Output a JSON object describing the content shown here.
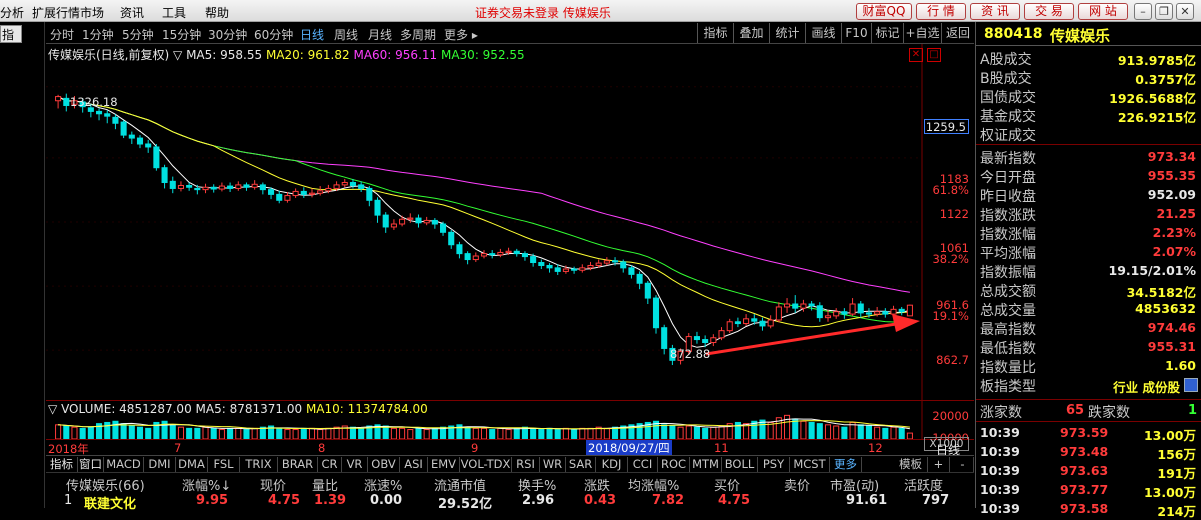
{
  "menubar": {
    "items": [
      "分析",
      "扩展行情市场",
      "资讯",
      "工具",
      "帮助"
    ],
    "notice": "证券交易未登录 传媒娱乐",
    "buttons": [
      "财富QQ",
      "行 情",
      "资 讯",
      "交 易",
      "网 站"
    ]
  },
  "leftstrip": {
    "label": "指标"
  },
  "periods": [
    "分时",
    "1分钟",
    "5分钟",
    "15分钟",
    "30分钟",
    "60分钟",
    "日线",
    "周线",
    "月线",
    "多周期",
    "更多 ▸"
  ],
  "active_period": "日线",
  "right_tools": [
    "指标",
    "叠加",
    "统计",
    "画线",
    "F10",
    "标记",
    "+自选",
    "返回"
  ],
  "main_legend": {
    "name": "传媒娱乐(日线,前复权)",
    "ma5": "MA5: 958.55",
    "ma20": "MA20: 961.82",
    "ma60": "MA60: 956.11",
    "ma30": "MA30: 952.55"
  },
  "price_axis": {
    "labels": [
      "1259.5",
      "1183",
      "61.8%",
      "1122",
      "1061",
      "38.2%",
      "961.6",
      "19.1%",
      "862.7"
    ],
    "highlight": "1259.5"
  },
  "annotations": {
    "high": "1326.18",
    "low": "872.88"
  },
  "volume_legend": {
    "volume": "VOLUME: 4851287.00",
    "ma5": "MA5: 8781371.00",
    "ma10": "MA10: 11374784.00"
  },
  "volume_axis": {
    "labels": [
      "20000",
      "10000",
      "X1000"
    ]
  },
  "xaxis": {
    "labels": [
      "2018年",
      "7",
      "8",
      "9",
      "2018/09/27/四",
      "11",
      "12"
    ],
    "period_button": "日线"
  },
  "indicators": [
    "指标",
    "窗口",
    "MACD",
    "DMI",
    "DMA",
    "FSL",
    "TRIX",
    "BRAR",
    "CR",
    "VR",
    "OBV",
    "ASI",
    "EMV",
    "VOL-TDX",
    "RSI",
    "WR",
    "SAR",
    "KDJ",
    "CCI",
    "ROC",
    "MTM",
    "BOLL",
    "PSY",
    "MCST",
    "更多"
  ],
  "indicator_right": [
    "模板",
    "+",
    "-"
  ],
  "table": {
    "headers": [
      "传媒娱乐(66)",
      "涨幅%↓",
      "现价",
      "量比",
      "涨速%",
      "流通市值",
      "换手%",
      "涨跌",
      "均涨幅%",
      "买价",
      "卖价",
      "市盈(动)",
      "活跃度"
    ],
    "row": [
      "1",
      "联建文化",
      "9.95",
      "4.75",
      "1.39",
      "0.00",
      "29.52亿",
      "2.96",
      "0.43",
      "7.82",
      "4.75",
      "",
      "91.61",
      "797"
    ]
  },
  "right_panel": {
    "code": "880418",
    "name": "传媒娱乐",
    "rows": [
      {
        "label": "A股成交",
        "value": "913.9785亿",
        "color": "yellow"
      },
      {
        "label": "B股成交",
        "value": "0.3757亿",
        "color": "yellow"
      },
      {
        "label": "国债成交",
        "value": "1926.5688亿",
        "color": "yellow"
      },
      {
        "label": "基金成交",
        "value": "226.9215亿",
        "color": "yellow"
      },
      {
        "label": "权证成交",
        "value": "",
        "color": "yellow"
      },
      {
        "label": "最新指数",
        "value": "973.34",
        "color": "red"
      },
      {
        "label": "今日开盘",
        "value": "955.35",
        "color": "red"
      },
      {
        "label": "昨日收盘",
        "value": "952.09",
        "color": "white"
      },
      {
        "label": "指数涨跌",
        "value": "21.25",
        "color": "red"
      },
      {
        "label": "指数涨幅",
        "value": "2.23%",
        "color": "red"
      },
      {
        "label": "平均涨幅",
        "value": "2.07%",
        "color": "red"
      },
      {
        "label": "指数振幅",
        "value": "19.15/2.01%",
        "color": "white"
      },
      {
        "label": "总成交额",
        "value": "34.5182亿",
        "color": "yellow"
      },
      {
        "label": "总成交量",
        "value": "4853632",
        "color": "yellow"
      },
      {
        "label": "最高指数",
        "value": "974.46",
        "color": "red"
      },
      {
        "label": "最低指数",
        "value": "955.31",
        "color": "red"
      },
      {
        "label": "指数量比",
        "value": "1.60",
        "color": "yellow"
      },
      {
        "label": "板指类型",
        "value": "行业 成份股",
        "color": "yellow"
      }
    ],
    "breadth": {
      "up_label": "涨家数",
      "up_value": "65",
      "down_label": "跌家数",
      "down_value": "1"
    },
    "trades": [
      {
        "time": "10:39",
        "price": "973.59",
        "vol": "13.00万"
      },
      {
        "time": "10:39",
        "price": "973.48",
        "vol": "156万"
      },
      {
        "time": "10:39",
        "price": "973.63",
        "vol": "191万"
      },
      {
        "time": "10:39",
        "price": "973.77",
        "vol": "13.00万"
      },
      {
        "time": "10:39",
        "price": "973.58",
        "vol": "214万"
      }
    ]
  },
  "chart_data": {
    "type": "candlestick",
    "ylim": [
      840,
      1380
    ],
    "candles": [
      [
        1318,
        1325,
        1305,
        1328
      ],
      [
        1322,
        1310,
        1300,
        1330
      ],
      [
        1312,
        1318,
        1305,
        1326
      ],
      [
        1316,
        1308,
        1298,
        1322
      ],
      [
        1306,
        1300,
        1290,
        1312
      ],
      [
        1300,
        1296,
        1285,
        1305
      ],
      [
        1296,
        1292,
        1280,
        1302
      ],
      [
        1290,
        1280,
        1270,
        1295
      ],
      [
        1282,
        1260,
        1255,
        1285
      ],
      [
        1260,
        1255,
        1245,
        1266
      ],
      [
        1255,
        1245,
        1238,
        1260
      ],
      [
        1245,
        1240,
        1230,
        1252
      ],
      [
        1240,
        1205,
        1200,
        1245
      ],
      [
        1205,
        1180,
        1170,
        1210
      ],
      [
        1182,
        1170,
        1162,
        1190
      ],
      [
        1170,
        1175,
        1165,
        1182
      ],
      [
        1175,
        1172,
        1166,
        1180
      ],
      [
        1170,
        1168,
        1160,
        1176
      ],
      [
        1168,
        1172,
        1162,
        1178
      ],
      [
        1172,
        1169,
        1163,
        1177
      ],
      [
        1169,
        1174,
        1165,
        1180
      ],
      [
        1174,
        1170,
        1164,
        1180
      ],
      [
        1170,
        1176,
        1166,
        1182
      ],
      [
        1176,
        1172,
        1166,
        1180
      ],
      [
        1172,
        1177,
        1168,
        1184
      ],
      [
        1176,
        1168,
        1160,
        1180
      ],
      [
        1168,
        1160,
        1152,
        1172
      ],
      [
        1160,
        1150,
        1145,
        1166
      ],
      [
        1150,
        1158,
        1146,
        1164
      ],
      [
        1158,
        1165,
        1154,
        1170
      ],
      [
        1165,
        1160,
        1154,
        1172
      ],
      [
        1160,
        1162,
        1155,
        1170
      ],
      [
        1162,
        1166,
        1158,
        1174
      ],
      [
        1166,
        1170,
        1162,
        1176
      ],
      [
        1170,
        1176,
        1166,
        1182
      ],
      [
        1176,
        1180,
        1172,
        1186
      ],
      [
        1180,
        1175,
        1170,
        1186
      ],
      [
        1176,
        1170,
        1164,
        1182
      ],
      [
        1170,
        1150,
        1140,
        1174
      ],
      [
        1150,
        1125,
        1112,
        1155
      ],
      [
        1125,
        1105,
        1095,
        1130
      ],
      [
        1105,
        1110,
        1100,
        1118
      ],
      [
        1110,
        1118,
        1106,
        1124
      ],
      [
        1118,
        1120,
        1112,
        1128
      ],
      [
        1120,
        1112,
        1104,
        1126
      ],
      [
        1112,
        1116,
        1108,
        1122
      ],
      [
        1116,
        1110,
        1102,
        1120
      ],
      [
        1110,
        1096,
        1090,
        1114
      ],
      [
        1096,
        1075,
        1068,
        1100
      ],
      [
        1075,
        1060,
        1052,
        1080
      ],
      [
        1060,
        1050,
        1042,
        1064
      ],
      [
        1050,
        1056,
        1046,
        1062
      ],
      [
        1056,
        1060,
        1052,
        1066
      ],
      [
        1060,
        1058,
        1052,
        1066
      ],
      [
        1058,
        1062,
        1054,
        1068
      ],
      [
        1062,
        1064,
        1058,
        1070
      ],
      [
        1064,
        1060,
        1055,
        1068
      ],
      [
        1060,
        1055,
        1048,
        1064
      ],
      [
        1055,
        1045,
        1038,
        1060
      ],
      [
        1045,
        1040,
        1034,
        1050
      ],
      [
        1040,
        1036,
        1028,
        1044
      ],
      [
        1036,
        1030,
        1024,
        1042
      ],
      [
        1030,
        1034,
        1026,
        1040
      ],
      [
        1034,
        1032,
        1026,
        1038
      ],
      [
        1032,
        1036,
        1028,
        1042
      ],
      [
        1036,
        1040,
        1032,
        1046
      ],
      [
        1040,
        1044,
        1036,
        1050
      ],
      [
        1044,
        1048,
        1040,
        1054
      ],
      [
        1048,
        1046,
        1040,
        1054
      ],
      [
        1046,
        1036,
        1028,
        1050
      ],
      [
        1036,
        1025,
        1018,
        1040
      ],
      [
        1025,
        1010,
        1000,
        1030
      ],
      [
        1010,
        985,
        975,
        1014
      ],
      [
        985,
        935,
        925,
        990
      ],
      [
        935,
        900,
        890,
        940
      ],
      [
        900,
        880,
        872,
        906
      ],
      [
        880,
        895,
        873,
        900
      ],
      [
        895,
        920,
        890,
        926
      ],
      [
        920,
        915,
        908,
        928
      ],
      [
        915,
        910,
        902,
        922
      ],
      [
        910,
        918,
        904,
        924
      ],
      [
        918,
        930,
        914,
        936
      ],
      [
        930,
        945,
        926,
        950
      ],
      [
        945,
        942,
        936,
        952
      ],
      [
        942,
        950,
        938,
        958
      ],
      [
        950,
        946,
        940,
        958
      ],
      [
        946,
        938,
        930,
        952
      ],
      [
        938,
        948,
        934,
        956
      ],
      [
        948,
        970,
        944,
        978
      ],
      [
        970,
        975,
        960,
        985
      ],
      [
        975,
        968,
        960,
        990
      ],
      [
        968,
        975,
        962,
        982
      ],
      [
        975,
        972,
        964,
        980
      ],
      [
        972,
        952,
        945,
        978
      ],
      [
        952,
        955,
        945,
        965
      ],
      [
        955,
        962,
        950,
        968
      ],
      [
        962,
        958,
        950,
        968
      ],
      [
        958,
        975,
        955,
        985
      ],
      [
        975,
        960,
        952,
        980
      ],
      [
        960,
        958,
        952,
        968
      ],
      [
        958,
        962,
        954,
        970
      ],
      [
        962,
        958,
        952,
        968
      ],
      [
        958,
        966,
        954,
        972
      ],
      [
        966,
        962,
        956,
        970
      ],
      [
        955,
        973,
        955,
        974
      ]
    ],
    "ma5_color": "#ffffff",
    "ma20_color": "#ffff33",
    "ma60_color": "#ff40ff",
    "ma30_color": "#33ff33",
    "volume": [
      12,
      11,
      10,
      9,
      10,
      13,
      14,
      15,
      13,
      11,
      10,
      9,
      14,
      15,
      12,
      10,
      9,
      9,
      10,
      9,
      8,
      9,
      9,
      8,
      9,
      10,
      11,
      9,
      8,
      8,
      9,
      9,
      8,
      9,
      10,
      11,
      10,
      9,
      11,
      12,
      11,
      9,
      9,
      8,
      9,
      8,
      9,
      10,
      11,
      12,
      10,
      9,
      9,
      8,
      9,
      8,
      9,
      10,
      9,
      8,
      9,
      8,
      9,
      8,
      9,
      9,
      10,
      9,
      10,
      11,
      12,
      13,
      14,
      15,
      12,
      11,
      10,
      11,
      10,
      9,
      10,
      11,
      13,
      14,
      13,
      15,
      16,
      14,
      18,
      20,
      17,
      15,
      14,
      13,
      12,
      11,
      10,
      14,
      12,
      11,
      10,
      9,
      10,
      9,
      5
    ],
    "vol_ma5": "#ffffff",
    "vol_ma10": "#ffff33"
  }
}
